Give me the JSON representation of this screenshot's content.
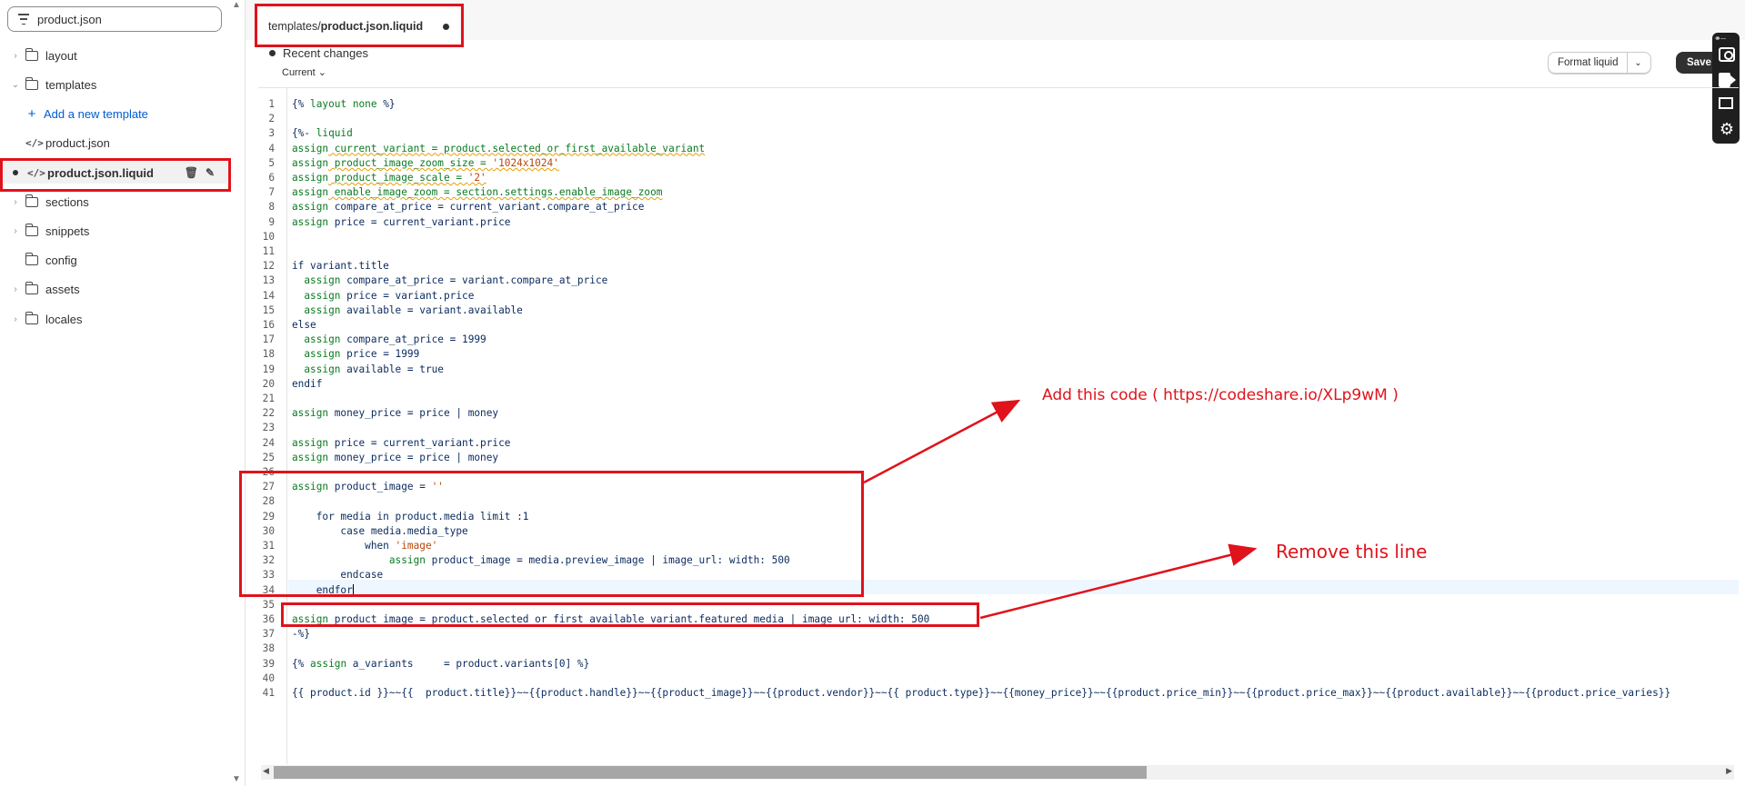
{
  "sidebar": {
    "search_value": "product.json",
    "items": [
      {
        "label": "layout",
        "type": "folder"
      },
      {
        "label": "templates",
        "type": "folder"
      },
      {
        "label": "Add a new template",
        "type": "link"
      },
      {
        "label": "product.json",
        "type": "file"
      },
      {
        "label": "product.json.liquid",
        "type": "file"
      },
      {
        "label": "sections",
        "type": "folder"
      },
      {
        "label": "snippets",
        "type": "folder"
      },
      {
        "label": "config",
        "type": "folder"
      },
      {
        "label": "assets",
        "type": "folder"
      },
      {
        "label": "locales",
        "type": "folder"
      }
    ]
  },
  "tab": {
    "path_prefix": "templates/",
    "file_name": "product.json.liquid"
  },
  "toolbar": {
    "recent_changes": "Recent changes",
    "version": "Current",
    "format_label": "Format liquid",
    "save_label": "Save"
  },
  "editor": {
    "line_numbers": [
      "1",
      "2",
      "3",
      "4",
      "5",
      "6",
      "7",
      "8",
      "9",
      "10",
      "11",
      "12",
      "13",
      "14",
      "15",
      "16",
      "17",
      "18",
      "19",
      "20",
      "21",
      "22",
      "23",
      "24",
      "25",
      "26",
      "27",
      "28",
      "29",
      "30",
      "31",
      "32",
      "33",
      "34",
      "35",
      "36",
      "37",
      "38",
      "39",
      "40",
      "41"
    ],
    "lines": [
      "{% layout none %}",
      "",
      "{%- liquid",
      "assign current_variant = product.selected_or_first_available_variant",
      "assign product_image_zoom_size = '1024x1024'",
      "assign product_image_scale = '2'",
      "assign enable_image_zoom = section.settings.enable_image_zoom",
      "assign compare_at_price = current_variant.compare_at_price",
      "assign price = current_variant.price",
      "",
      "",
      "if variant.title",
      "  assign compare_at_price = variant.compare_at_price",
      "  assign price = variant.price",
      "  assign available = variant.available",
      "else",
      "  assign compare_at_price = 1999",
      "  assign price = 1999",
      "  assign available = true",
      "endif",
      "",
      "assign money_price = price | money",
      "",
      "assign price = current_variant.price",
      "assign money_price = price | money",
      "",
      "assign product_image = ''",
      "",
      "    for media in product.media limit :1",
      "        case media.media_type",
      "            when 'image'",
      "                assign product_image = media.preview_image | image_url: width: 500",
      "        endcase",
      "    endfor",
      "",
      "assign product_image = product.selected_or_first_available_variant.featured_media | image_url: width: 500",
      "-%}",
      "",
      "{% assign a_variants     = product.variants[0] %}",
      "",
      "{{ product.id }}~~{{  product.title}}~~{{product.handle}}~~{{product_image}}~~{{product.vendor}}~~{{ product.type}}~~{{money_price}}~~{{product.price_min}}~~{{product.price_max}}~~{{product.available}}~~{{product.price_varies}}"
    ]
  },
  "annotations": {
    "add_code": "Add this code ( https://codeshare.io/XLp9wM )",
    "remove_line": "Remove this line",
    "color": "#e0121b"
  }
}
